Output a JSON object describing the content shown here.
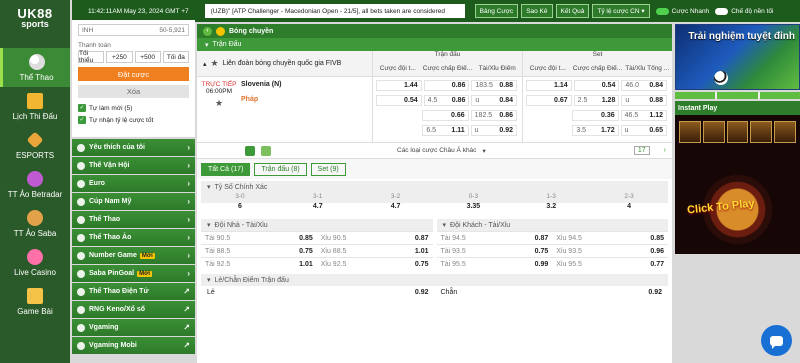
{
  "brand": {
    "line1": "UK88",
    "line2": "sports"
  },
  "leftnav": [
    {
      "label": "Thể Thao",
      "icon": "soccer-ball-icon",
      "active": true
    },
    {
      "label": "Lịch Thi Đấu",
      "icon": "calendar-icon",
      "active": false
    },
    {
      "label": "ESPORTS",
      "icon": "esports-icon",
      "active": false
    },
    {
      "label": "TT Ảo Betradar",
      "icon": "virtual-icon",
      "active": false
    },
    {
      "label": "TT Ảo Saba",
      "icon": "saba-icon",
      "active": false
    },
    {
      "label": "Live Casino",
      "icon": "casino-icon",
      "active": false
    },
    {
      "label": "Game Bài",
      "icon": "cards-icon",
      "active": false
    }
  ],
  "slip": {
    "field_label": "INH",
    "field_value": "50-5,921",
    "payment_label": "Thanh toán",
    "min_label": "Tối thiểu",
    "chip1": "+250",
    "chip2": "+500",
    "max_label": "Tối đa",
    "place_bet": "Đặt cược",
    "clear": "Xóa",
    "opt1": "Tự làm mới (5)",
    "opt2": "Tự nhận tỷ lệ cược tốt"
  },
  "sports": [
    {
      "label": "Yêu thích của tôi",
      "tag": "",
      "arrow": "›"
    },
    {
      "label": "Thế Vận Hội",
      "tag": "",
      "arrow": "›"
    },
    {
      "label": "Euro",
      "tag": "",
      "arrow": "›"
    },
    {
      "label": "Cúp Nam Mỹ",
      "tag": "",
      "arrow": "›"
    },
    {
      "label": "Thể Thao",
      "tag": "",
      "arrow": "›"
    },
    {
      "label": "Thể Thao Ảo",
      "tag": "",
      "arrow": "›"
    },
    {
      "label": "Number Game",
      "tag": "Mới",
      "arrow": "›"
    },
    {
      "label": "Saba PinGoal",
      "tag": "Mới",
      "arrow": "›"
    },
    {
      "label": "Thể Thao Điện Tử",
      "tag": "",
      "arrow": "↗"
    },
    {
      "label": "RNG Keno/Xổ số",
      "tag": "",
      "arrow": "↗"
    },
    {
      "label": "Vgaming",
      "tag": "",
      "arrow": "↗"
    },
    {
      "label": "Vgaming Mobi",
      "tag": "",
      "arrow": "↗"
    }
  ],
  "topbar": {
    "clock": "11:42:11AM May 23, 2024 GMT +7",
    "ticker": "(UZB)\" [ATP Challenger - Macedonian Open - 21/5], all bets taken are considered",
    "btn1": "Bảng Cược",
    "btn2": "Sao Kê",
    "btn3": "Kết Quả",
    "odds_type": "Tỷ lệ cược CN ▾",
    "toggle1": "Cược Nhanh",
    "toggle2": "Chế độ nền tối"
  },
  "main": {
    "title": "Bóng chuyền",
    "subtitle": "Trận Đấu",
    "league": "Liên đoàn bóng chuyền quốc gia FIVB",
    "grp1_title": "Trận đấu",
    "grp2_title": "Set",
    "cols": [
      "Cược đội t...",
      "Cược chấp Điể...",
      "Tài/Xỉu Điểm"
    ],
    "cols2": [
      "Cược đội t...",
      "Cược chấp Điể...",
      "Tài/Xỉu Tổng ..."
    ],
    "live": "TRỰC TIẾP",
    "time": "06:00PM",
    "team1": "Slovenia (N)",
    "team2": "Pháp",
    "more_bets": "Các loại cược Châu Á khác",
    "more_count": "17",
    "tabs": [
      "Tất Cả (17)",
      "Trận đấu (8)",
      "Set (9)"
    ]
  },
  "odds": {
    "m1": {
      "ml": "1.44",
      "hcp_h": "",
      "hcp": "0.86",
      "ou_h": "183.5",
      "ou": "0.88"
    },
    "m2": {
      "ml": "0.54",
      "hcp_h": "4.5",
      "hcp": "0.86",
      "ou_h": "u",
      "ou": "0.84"
    },
    "m3": {
      "ml": "",
      "hcp_h": "",
      "hcp": "0.66",
      "ou_h": "182.5",
      "ou": "0.86"
    },
    "m4": {
      "ml": "",
      "hcp_h": "6.5",
      "hcp": "1.11",
      "ou_h": "u",
      "ou": "0.92"
    },
    "s1": {
      "ml": "1.14",
      "hcp_h": "",
      "hcp": "0.54",
      "ou_h": "46.0",
      "ou": "0.84"
    },
    "s2": {
      "ml": "0.67",
      "hcp_h": "2.5",
      "hcp": "1.28",
      "ou_h": "u",
      "ou": "0.88"
    },
    "s3": {
      "ml": "",
      "hcp_h": "",
      "hcp": "0.36",
      "ou_h": "46.5",
      "ou": "1.12"
    },
    "s4": {
      "ml": "",
      "hcp_h": "3.5",
      "hcp": "1.72",
      "ou_h": "u",
      "ou": "0.65"
    }
  },
  "correct_score": {
    "title": "Tỷ Số Chính Xác",
    "scores": [
      "3-0",
      "3-1",
      "3-2",
      "0-3",
      "1-3",
      "2-3"
    ],
    "values": [
      "6",
      "4.7",
      "4.7",
      "3.35",
      "3.2",
      "4"
    ]
  },
  "home_ou": {
    "title": "Đội Nhà - Tài/Xỉu",
    "rows": [
      {
        "o": "Tài 90.5",
        "ov": "0.85",
        "u": "Xỉu 90.5",
        "uv": "0.87"
      },
      {
        "o": "Tài 88.5",
        "ov": "0.75",
        "u": "Xỉu 88.5",
        "uv": "1.01"
      },
      {
        "o": "Tài 92.5",
        "ov": "1.01",
        "u": "Xỉu 92.5",
        "uv": "0.75"
      }
    ]
  },
  "away_ou": {
    "title": "Đội Khách - Tài/Xỉu",
    "rows": [
      {
        "o": "Tài 94.5",
        "ov": "0.87",
        "u": "Xỉu 94.5",
        "uv": "0.85"
      },
      {
        "o": "Tài 93.5",
        "ov": "0.75",
        "u": "Xỉu 93.5",
        "uv": "0.96"
      },
      {
        "o": "Tài 95.5",
        "ov": "0.99",
        "u": "Xỉu 95.5",
        "uv": "0.77"
      }
    ]
  },
  "odd_even": {
    "title": "Lẻ/Chẵn Điểm Trận đấu",
    "odd": "Lẻ",
    "odd_v": "0.92",
    "even": "Chẵn",
    "even_v": "0.92"
  },
  "promos": {
    "banner_text": "Trải nghiệm tuyệt đỉnh",
    "instant_play": "Instant Play",
    "click_text": "Click To Play"
  }
}
